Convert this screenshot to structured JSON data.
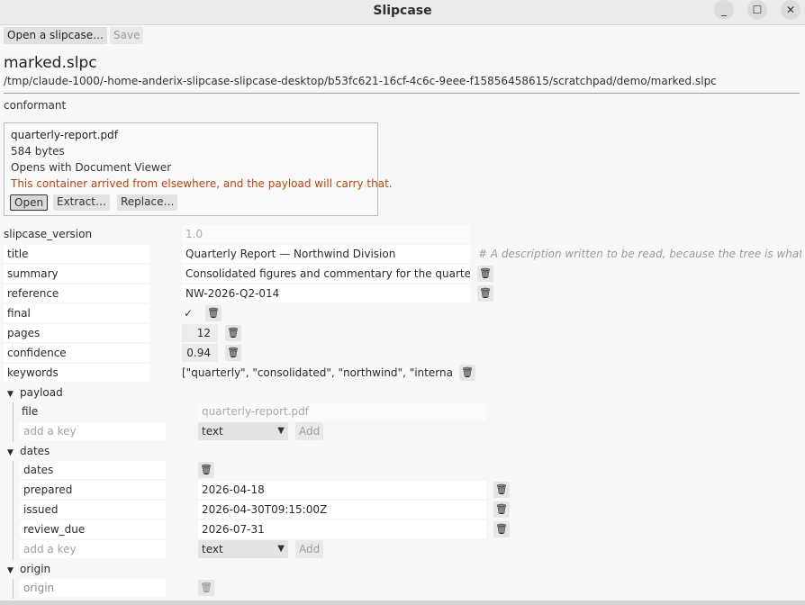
{
  "window": {
    "title": "Slipcase",
    "minimize_glyph": "_",
    "maximize_glyph": "☐",
    "close_glyph": "✕"
  },
  "toolbar": {
    "open_label": "Open a slipcase…",
    "save_label": "Save"
  },
  "document": {
    "filename": "marked.slpc",
    "path": "/tmp/claude-1000/-home-anderix-slipcase-slipcase-desktop/b53fc621-16cf-4c6c-9eee-f15856458615/scratchpad/demo/marked.slpc",
    "conformance": "conformant"
  },
  "payload_box": {
    "name": "quarterly-report.pdf",
    "size": "584 bytes",
    "opens_with": "Opens with Document Viewer",
    "warning": "This container arrived from elsewhere, and the payload will carry that.",
    "open_label": "Open",
    "extract_label": "Extract…",
    "replace_label": "Replace…"
  },
  "fields": {
    "slipcase_version": {
      "key": "slipcase_version",
      "value": "1.0"
    },
    "title": {
      "key": "title",
      "value": "Quarterly Report — Northwind Division",
      "hint": "# A description written to be read, because the tree is what a y"
    },
    "summary": {
      "key": "summary",
      "value": "Consolidated figures and commentary for the quarter."
    },
    "reference": {
      "key": "reference",
      "value": "NW-2026-Q2-014"
    },
    "final": {
      "key": "final",
      "checked": true,
      "check_glyph": "✓"
    },
    "pages": {
      "key": "pages",
      "value": "12"
    },
    "confidence": {
      "key": "confidence",
      "value": "0.94"
    },
    "keywords": {
      "key": "keywords",
      "value": "[\"quarterly\", \"consolidated\", \"northwind\", \"internal\"]"
    }
  },
  "payload_group": {
    "label": "payload",
    "file_key": "file",
    "file_value": "quarterly-report.pdf",
    "add_key_placeholder": "add a key",
    "type_value": "text",
    "add_label": "Add"
  },
  "dates_group": {
    "label": "dates",
    "entries": [
      {
        "key": "dates",
        "value": ""
      },
      {
        "key": "prepared",
        "value": "2026-04-18"
      },
      {
        "key": "issued",
        "value": "2026-04-30T09:15:00Z"
      },
      {
        "key": "review_due",
        "value": "2026-07-31"
      }
    ],
    "add_key_placeholder": "add a key",
    "type_value": "text",
    "add_label": "Add"
  },
  "origin_group": {
    "label": "origin",
    "first_key": "origin"
  },
  "icons": {
    "trash": "trash-icon",
    "disclosure": "triangle-down-icon",
    "caret": "caret-down-icon"
  },
  "glyphs": {
    "trash": "🗑",
    "tri_down": "▼",
    "caret": "▼"
  }
}
